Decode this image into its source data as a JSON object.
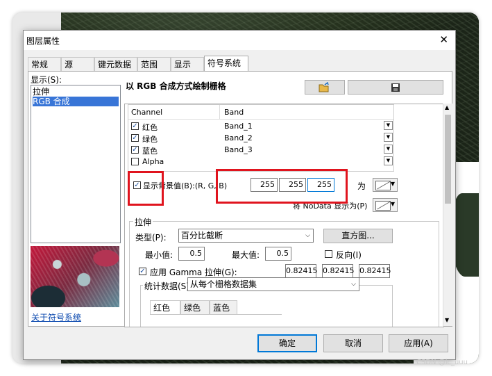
{
  "window": {
    "title": "图层属性",
    "close": "✕"
  },
  "tabs": [
    "常规",
    "源",
    "键元数据",
    "范围",
    "显示",
    "符号系统"
  ],
  "left": {
    "show_label": "显示(S):",
    "items": [
      "拉伸",
      "RGB 合成"
    ],
    "selected_index": 1,
    "about_link": "关于符号系统"
  },
  "panel_title": "以 RGB 合成方式绘制栅格",
  "toolbar_icons": [
    "open-folder-icon",
    "save-disk-icon"
  ],
  "bands": {
    "headers": [
      "Channel",
      "Band"
    ],
    "rows": [
      {
        "channel": "红色",
        "band": "Band_1",
        "checked": true
      },
      {
        "channel": "绿色",
        "band": "Band_2",
        "checked": true
      },
      {
        "channel": "蓝色",
        "band": "Band_3",
        "checked": true
      },
      {
        "channel": "Alpha",
        "band": "",
        "checked": false
      }
    ]
  },
  "background": {
    "checkbox_label": "显示背景值(B):(R, G, B)",
    "checked": true,
    "r": "255",
    "g": "255",
    "b": "255",
    "as_label": "为",
    "nodata_label": "将 NoData 显示为(P)"
  },
  "stretch": {
    "group": "拉伸",
    "type_label": "类型(P):",
    "type_value": "百分比截断",
    "histogram_button": "直方图...",
    "min_label": "最小值:",
    "min_value": "0.5",
    "max_label": "最大值:",
    "max_value": "0.5",
    "invert_label": "反向(I)",
    "invert_checked": false,
    "gamma_label": "应用 Gamma 拉伸(G):",
    "gamma_checked": true,
    "gamma_values": [
      "0.82415",
      "0.82415",
      "0.82415"
    ],
    "stats_label": "统计数据(S)",
    "stats_value": "从每个栅格数据集",
    "stats_tabs": [
      "红色",
      "绿色",
      "蓝色"
    ]
  },
  "buttons": {
    "ok": "确定",
    "cancel": "取消",
    "apply": "应用(A)"
  },
  "watermark": "CSDN @lc_uuu"
}
